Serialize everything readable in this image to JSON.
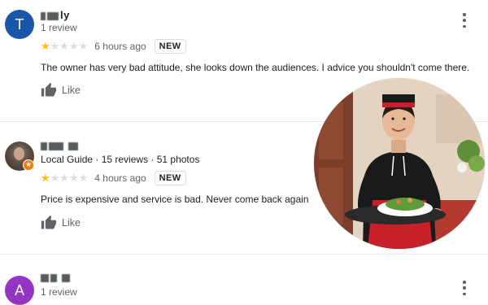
{
  "reviews": [
    {
      "avatar_letter": "T",
      "avatar_color": "#1a56a8",
      "name": "▘▖▗ly",
      "meta": "1 review",
      "rating": 1,
      "max_rating": 5,
      "time": "6 hours ago",
      "badge": "NEW",
      "text": "The owner has very bad attitude, she looks down the audiences. I advice you shouldn't come there.",
      "like_label": "Like"
    },
    {
      "avatar_letter": "",
      "name": "P▘▘ ▘▗",
      "meta": "Local Guide · 15 reviews · 51 photos",
      "rating": 1,
      "max_rating": 5,
      "time": "4 hours ago",
      "badge": "NEW",
      "text": "Price is expensive and service is bad. Never come back again",
      "like_label": "Like"
    },
    {
      "avatar_letter": "A",
      "avatar_color": "#9334c2",
      "name": "▘▗ ▘",
      "meta": "1 review"
    }
  ],
  "icons": {
    "like": "thumbs-up-icon",
    "more": "more-vert-icon",
    "local_guide": "local-guide-badge-icon"
  },
  "colors": {
    "star": "#fbbc04",
    "star_empty": "#dadce0",
    "secondary_text": "#5f6368"
  }
}
